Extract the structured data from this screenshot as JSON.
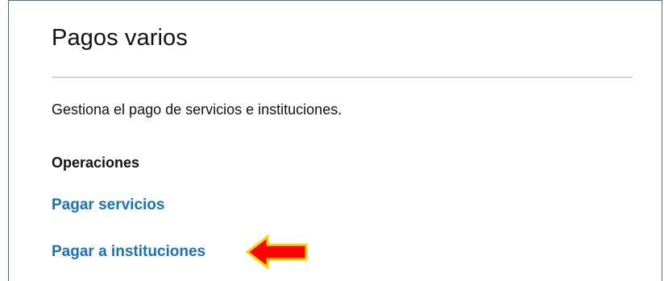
{
  "page": {
    "title": "Pagos varios",
    "description": "Gestiona el pago de servicios e instituciones.",
    "operations_heading": "Operaciones",
    "operations": [
      {
        "label": "Pagar servicios"
      },
      {
        "label": "Pagar a instituciones"
      }
    ]
  },
  "colors": {
    "link": "#1973b8",
    "text": "#121212",
    "frame_border": "#4a6e8a",
    "arrow_fill": "#ff0000",
    "arrow_outline": "#ffd200"
  },
  "annotations": {
    "arrow_icon": "left-arrow-icon"
  }
}
